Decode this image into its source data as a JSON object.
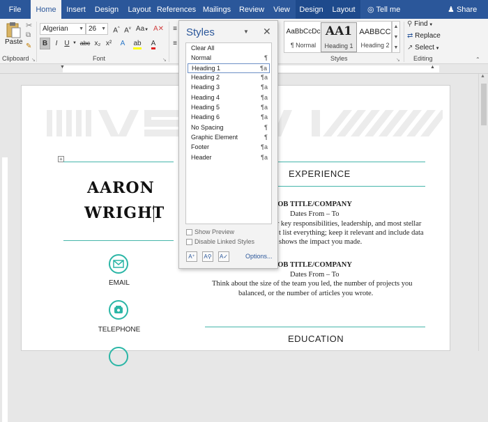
{
  "tabs": [
    {
      "label": "File"
    },
    {
      "label": "Home"
    },
    {
      "label": "Insert"
    },
    {
      "label": "Design"
    },
    {
      "label": "Layout"
    },
    {
      "label": "References"
    },
    {
      "label": "Mailings"
    },
    {
      "label": "Review"
    },
    {
      "label": "View"
    },
    {
      "label": "Design"
    },
    {
      "label": "Layout"
    }
  ],
  "tell_me": "Tell me",
  "share": "Share",
  "clipboard": {
    "paste": "Paste",
    "label": "Clipboard"
  },
  "font": {
    "name": "Algerian",
    "size": "26",
    "label": "Font",
    "bold": "B",
    "italic": "I",
    "underline": "U",
    "strike": "abc",
    "sub": "x₂",
    "sup": "x²",
    "change_case": "Aa"
  },
  "styles_group": {
    "label": "Styles",
    "items": [
      {
        "preview": "AaBbCcDc",
        "name": "¶ Normal"
      },
      {
        "preview": "AA1",
        "name": "Heading 1"
      },
      {
        "preview": "AABBCC",
        "name": "Heading 2"
      }
    ]
  },
  "editing": {
    "label": "Editing",
    "find": "Find",
    "replace": "Replace",
    "select": "Select"
  },
  "document": {
    "name_line1": "AARON",
    "name_line2": "WRIGHT",
    "experience": "EXPERIENCE",
    "job1_title": "JOB TITLE/COMPANY",
    "job1_dates": "Dates From – To",
    "job1_l1": "your key responsibilities, leadership, and most stellar",
    "job1_l2": "t list everything; keep it relevant and include data",
    "job1_l3": "shows the impact you made.",
    "job2_title": "JOB TITLE/COMPANY",
    "job2_dates": "Dates From – To",
    "job2_l1": "Think about the size of the team you led, the number of projects you",
    "job2_l2": "balanced, or the number of articles you wrote.",
    "email": "EMAIL",
    "telephone": "TELEPHONE",
    "education": "EDUCATION"
  },
  "styles_pane": {
    "title": "Styles",
    "items": [
      {
        "label": "Clear All",
        "mark": ""
      },
      {
        "label": "Normal",
        "mark": "¶"
      },
      {
        "label": "Heading 1",
        "mark": "¶a"
      },
      {
        "label": "Heading 2",
        "mark": "¶a"
      },
      {
        "label": "Heading 3",
        "mark": "¶a"
      },
      {
        "label": "Heading 4",
        "mark": "¶a"
      },
      {
        "label": "Heading 5",
        "mark": "¶a"
      },
      {
        "label": "Heading 6",
        "mark": "¶a"
      },
      {
        "label": "No Spacing",
        "mark": "¶"
      },
      {
        "label": "Graphic Element",
        "mark": "¶"
      },
      {
        "label": "Footer",
        "mark": "¶a"
      },
      {
        "label": "Header",
        "mark": "¶a"
      }
    ],
    "selected_index": 2,
    "show_preview": "Show Preview",
    "disable_linked": "Disable Linked Styles",
    "options": "Options..."
  },
  "colors": {
    "accent": "#2b579a",
    "teal": "#2bb6a6"
  }
}
